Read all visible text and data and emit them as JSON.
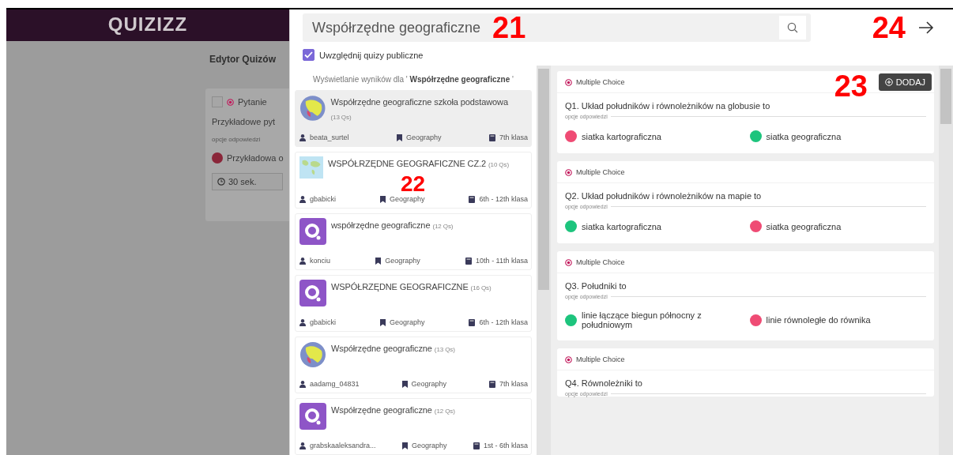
{
  "background": {
    "logo": "QUIZIZZ",
    "editor_title": "Edytor Quizów",
    "question_card": {
      "type_label": "Pytanie",
      "question": "Przykładowe pyt",
      "options_label": "opcje odpowiedzi",
      "answer": "Przykładowa o",
      "time": "30 sek."
    }
  },
  "search": {
    "value": "Współrzędne geograficzne",
    "callout": "21"
  },
  "include_public": {
    "label": "Uwzględnij quizy publiczne",
    "checked": true
  },
  "close_callout": "24",
  "results": {
    "caption": "Wyświetlanie wyników dla ' **Współrzędne geograficzne** '",
    "callout": "22",
    "quizzes": [
      {
        "title": "Współrzędne geograficzne szkoła podstawowa",
        "count": "(13 Qs)",
        "kind": "globe",
        "author": "beata_surtel",
        "subject": "Geography",
        "grade": "7th klasa",
        "selected": true
      },
      {
        "title": "WSPÓŁRZĘDNE GEOGRAFICZNE CZ.2",
        "count": "(10 Qs)",
        "kind": "map",
        "author": "gbabicki",
        "subject": "Geography",
        "grade": "6th - 12th klasa",
        "selected": false
      },
      {
        "title": "współrzędne geograficzne",
        "count": "(12 Qs)",
        "kind": "logo",
        "author": "konciu",
        "subject": "Geography",
        "grade": "10th - 11th klasa",
        "selected": false
      },
      {
        "title": "WSPÓŁRZĘDNE GEOGRAFICZNE",
        "count": "(16 Qs)",
        "kind": "logo",
        "author": "gbabicki",
        "subject": "Geography",
        "grade": "6th - 12th klasa",
        "selected": false
      },
      {
        "title": "Współrzędne geograficzne",
        "count": "(13 Qs)",
        "kind": "globe",
        "author": "aadamg_04831",
        "subject": "Geography",
        "grade": "7th klasa",
        "selected": false
      },
      {
        "title": "Współrzędne geograficzne",
        "count": "(12 Qs)",
        "kind": "logo",
        "author": "grabskaaleksandra...",
        "subject": "Geography",
        "grade": "1st - 6th klasa",
        "selected": false
      }
    ]
  },
  "add_button": {
    "label": "DODAJ",
    "callout": "23"
  },
  "questions": [
    {
      "type": "Multiple Choice",
      "text": "Q1. Układ południków i równoleżników na globusie to",
      "options_label": "opcje odpowiedzi",
      "answers": [
        {
          "text": "siatka kartograficzna",
          "color": "#ef4b74"
        },
        {
          "text": "siatka geograficzna",
          "color": "#1dc47d"
        }
      ]
    },
    {
      "type": "Multiple Choice",
      "text": "Q2. Układ południków i równoleżników na mapie to",
      "options_label": "opcje odpowiedzi",
      "answers": [
        {
          "text": "siatka kartograficzna",
          "color": "#1dc47d"
        },
        {
          "text": "siatka geograficzna",
          "color": "#ef4b74"
        }
      ]
    },
    {
      "type": "Multiple Choice",
      "text": "Q3. Południki to",
      "options_label": "opcje odpowiedzi",
      "answers": [
        {
          "text": "linie łączące biegun północny z południowym",
          "color": "#1dc47d"
        },
        {
          "text": "linie równoległe do równika",
          "color": "#ef4b74"
        }
      ]
    },
    {
      "type": "Multiple Choice",
      "text": "Q4. Równoleżniki to",
      "options_label": "opcje odpowiedzi"
    }
  ]
}
